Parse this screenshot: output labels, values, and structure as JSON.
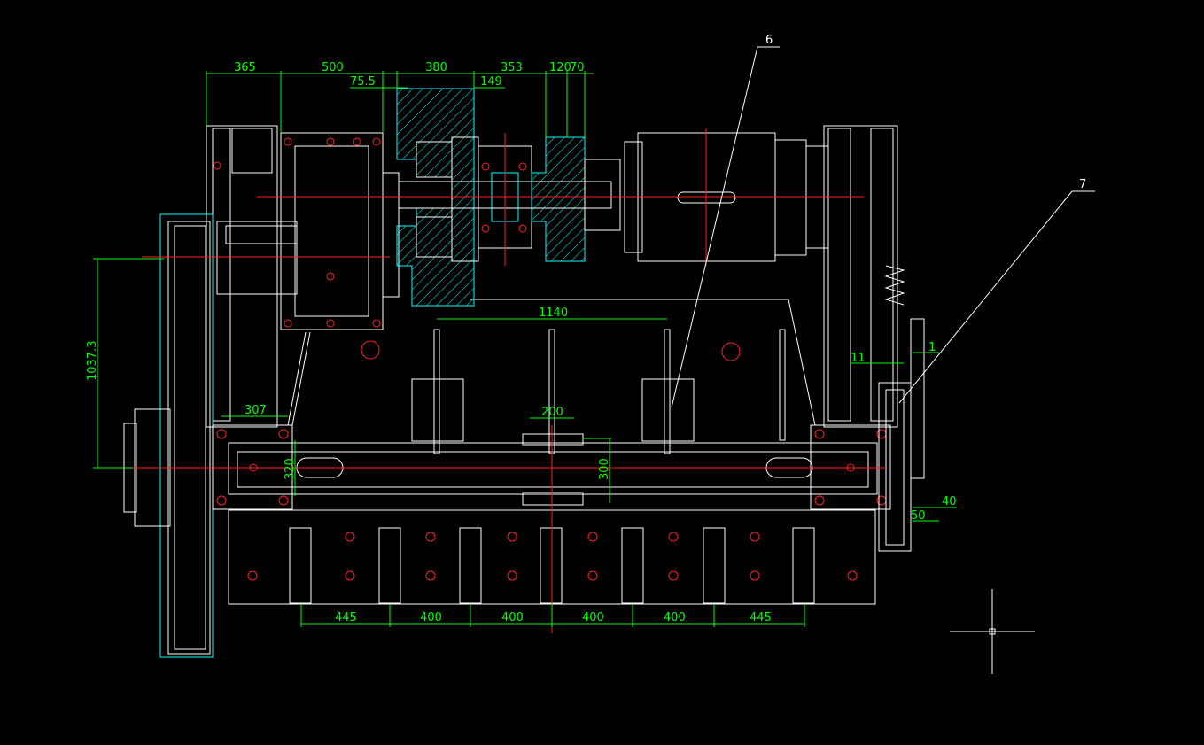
{
  "dimensions": {
    "top": [
      "365",
      "500",
      "380",
      "353",
      "120",
      "70"
    ],
    "top_sub": [
      "75.5",
      "149"
    ],
    "center_span": "1140",
    "left_height": "1037.3",
    "left_bracket": "307",
    "left_bracket_height": "320",
    "mid_width": "200",
    "mid_height": "300",
    "right_small": [
      "11",
      "1"
    ],
    "right_bottom": [
      "40",
      "50"
    ],
    "bottom": [
      "445",
      "400",
      "400",
      "400",
      "400",
      "445"
    ]
  },
  "callouts": [
    "6",
    "7"
  ],
  "colors": {
    "background": "#000000",
    "outline": "#ffffff",
    "dimension": "#00ff00",
    "section_hatch": "#00ffff",
    "centerline": "#ff2020"
  },
  "icons": [
    "crosshair-cursor-icon"
  ]
}
